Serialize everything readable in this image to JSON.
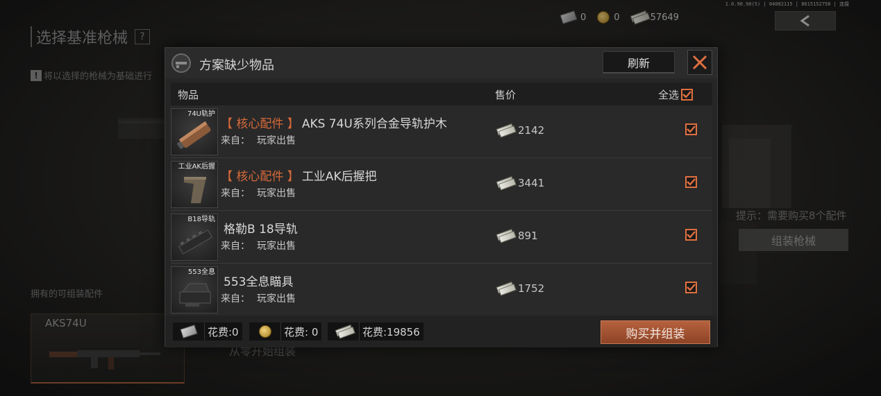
{
  "build_info": "1.0.90.90(5) | 04082115 | 8615152758 | 连接",
  "currency": {
    "ticket": "0",
    "coin": "0",
    "cash": "57649"
  },
  "background": {
    "title": "选择基准枪械",
    "help": "?",
    "hint": "将以选择的枪械为基础进行",
    "owned_label": "拥有的可组装配件",
    "owned_card_name": "AKS74U",
    "start_from_zero": "从零开始组装",
    "tip": "提示：需要购买8个配件",
    "assemble_button": "组装枪械"
  },
  "modal": {
    "title": "方案缺少物品",
    "refresh_label": "刷新",
    "columns": {
      "item": "物品",
      "price": "售价",
      "select_all": "全选"
    },
    "select_all_checked": true,
    "source_label": "来自：",
    "items": [
      {
        "thumb_label": "74U轨护",
        "tag": "【 核心配件 】",
        "name": "AKS 74U系列合金导轨护木",
        "source": "玩家出售",
        "price": "2142",
        "checked": true
      },
      {
        "thumb_label": "工业AK后握",
        "tag": "【 核心配件 】",
        "name": "工业AK后握把",
        "source": "玩家出售",
        "price": "3441",
        "checked": true
      },
      {
        "thumb_label": "B18导轨",
        "tag": "",
        "name": "格勒B 18导轨",
        "source": "玩家出售",
        "price": "891",
        "checked": true
      },
      {
        "thumb_label": "553全息",
        "tag": "",
        "name": "553全息瞄具",
        "source": "玩家出售",
        "price": "1752",
        "checked": true
      }
    ],
    "footer": {
      "ticket_cost": "花费:0",
      "coin_cost": "花费: 0",
      "cash_cost": "花费:19856",
      "buy_label": "购买并组装"
    }
  },
  "colors": {
    "accent": "#e07040",
    "buy_button": "#a9573a",
    "tag": "#d86a3a"
  }
}
